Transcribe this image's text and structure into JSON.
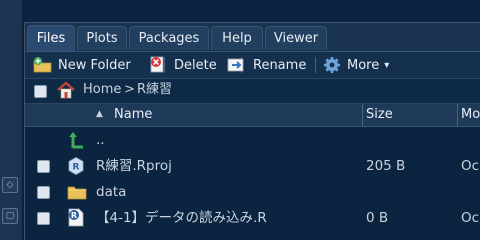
{
  "tabs": [
    "Files",
    "Plots",
    "Packages",
    "Help",
    "Viewer"
  ],
  "toolbar": {
    "new_folder": "New Folder",
    "delete": "Delete",
    "rename": "Rename",
    "more": "More",
    "more_arrow": "▾"
  },
  "breadcrumb": {
    "home": "Home",
    "separator": ">",
    "folder": "R練習"
  },
  "columns": {
    "name": "Name",
    "sort_indicator": "▲",
    "size": "Size",
    "modified": "Mo"
  },
  "rows": [
    {
      "name": "..",
      "size": "",
      "modified": ""
    },
    {
      "name": "R練習.Rproj",
      "size": "205 B",
      "modified": "Oc"
    },
    {
      "name": "data",
      "size": "",
      "modified": ""
    },
    {
      "name": "【4-1】データの読み込み.R",
      "size": "0 B",
      "modified": "Oc"
    }
  ],
  "colors": {
    "background": "#0b2540",
    "tab_active": "#2b4a6f",
    "folder": "#e8c15a",
    "up_arrow": "#3fae5a",
    "delete_red": "#d9343a",
    "rename_blue": "#3b78c4"
  }
}
